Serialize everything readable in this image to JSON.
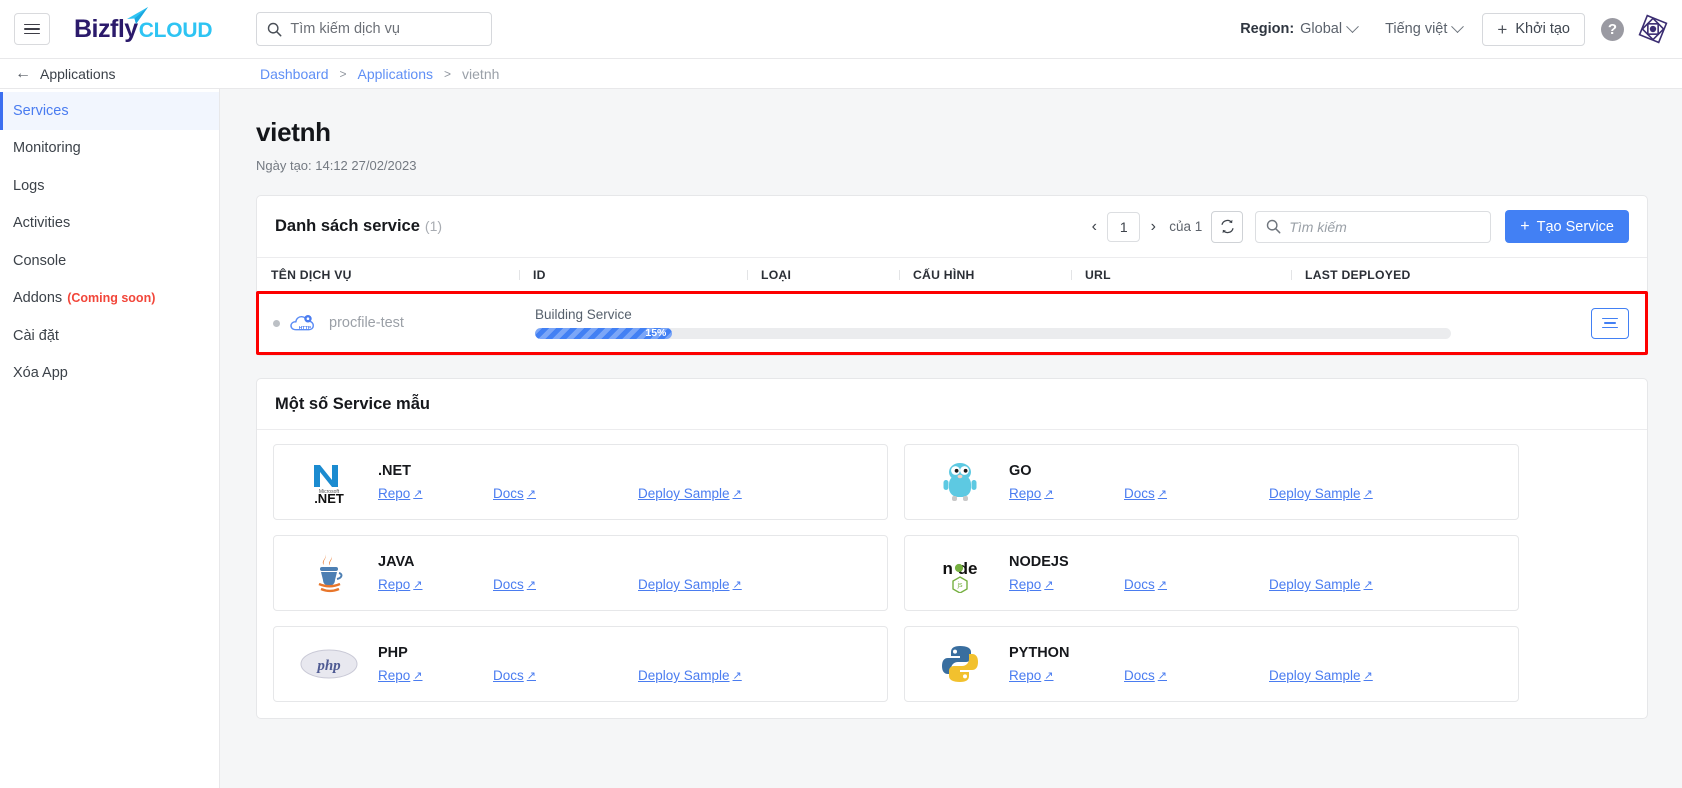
{
  "topbar": {
    "menu_icon": "hamburger-icon",
    "logo_primary": "Bizfly",
    "logo_secondary": "CLOUD",
    "search_placeholder": "Tìm kiếm dịch vụ",
    "region_label": "Region:",
    "region_value": "Global",
    "language": "Tiếng việt",
    "create_button": "Khởi tạo",
    "help": "?"
  },
  "breadcrumb": {
    "back_label": "Applications",
    "items": [
      {
        "label": "Dashboard",
        "current": false
      },
      {
        "label": "Applications",
        "current": false
      },
      {
        "label": "vietnh",
        "current": true
      }
    ],
    "separator": ">"
  },
  "sidebar": {
    "items": [
      {
        "label": "Services",
        "active": true,
        "badge": ""
      },
      {
        "label": "Monitoring",
        "active": false,
        "badge": ""
      },
      {
        "label": "Logs",
        "active": false,
        "badge": ""
      },
      {
        "label": "Activities",
        "active": false,
        "badge": ""
      },
      {
        "label": "Console",
        "active": false,
        "badge": ""
      },
      {
        "label": "Addons",
        "active": false,
        "badge": "(Coming soon)"
      },
      {
        "label": "Cài đặt",
        "active": false,
        "badge": ""
      },
      {
        "label": "Xóa App",
        "active": false,
        "badge": ""
      }
    ]
  },
  "page": {
    "title": "vietnh",
    "created": "Ngày tạo: 14:12 27/02/2023"
  },
  "service_list": {
    "title": "Danh sách service",
    "count": "(1)",
    "prev": "‹",
    "next": "›",
    "page": "1",
    "of": "của 1",
    "refresh_icon": "refresh-icon",
    "search_placeholder": "Tìm kiếm",
    "create_service": "Tạo Service",
    "columns": [
      "TÊN DỊCH VỤ",
      "ID",
      "LOẠI",
      "CẤU HÌNH",
      "URL",
      "LAST DEPLOYED"
    ],
    "rows": [
      {
        "name": "procfile-test",
        "status_dot": "#bcc0c5",
        "icon": "http-cloud-icon",
        "build_label": "Building Service",
        "progress_percent": 15,
        "progress_text": "15%",
        "id": "",
        "type": "",
        "config": "",
        "url": "",
        "last_deployed": "",
        "highlighted": true
      }
    ],
    "highlight_color": "#fd0000",
    "accent_color": "#4280f4"
  },
  "samples": {
    "title": "Một số Service mẫu",
    "link_repo": "Repo",
    "link_docs": "Docs",
    "link_deploy": "Deploy Sample",
    "ext_glyph": "↗",
    "cards": [
      {
        "name": ".NET",
        "icon": "dotnet-logo"
      },
      {
        "name": "GO",
        "icon": "go-gopher-logo"
      },
      {
        "name": "JAVA",
        "icon": "java-logo"
      },
      {
        "name": "NODEJS",
        "icon": "nodejs-logo"
      },
      {
        "name": "PHP",
        "icon": "php-logo"
      },
      {
        "name": "PYTHON",
        "icon": "python-logo"
      }
    ]
  }
}
